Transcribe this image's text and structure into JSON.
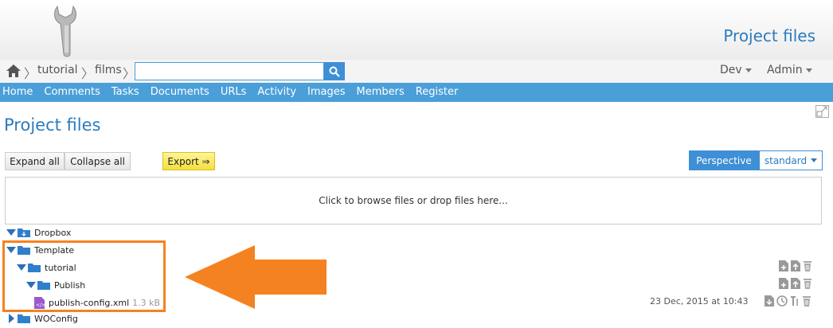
{
  "header": {
    "site_title": "Project files"
  },
  "breadcrumb": {
    "items": [
      "tutorial",
      "films"
    ],
    "separator": "〉"
  },
  "search": {
    "value": "",
    "placeholder": ""
  },
  "top_menu": {
    "dev_label": "Dev",
    "admin_label": "Admin"
  },
  "nav": {
    "items": [
      "Home",
      "Comments",
      "Tasks",
      "Documents",
      "URLs",
      "Activity",
      "Images",
      "Members",
      "Register"
    ]
  },
  "page": {
    "title": "Project files"
  },
  "toolbar": {
    "expand_all": "Expand all",
    "collapse_all": "Collapse all",
    "export": "Export ⇒",
    "perspective_label": "Perspective",
    "perspective_value": "standard"
  },
  "dropzone": {
    "text": "Click to browse files or drop files here..."
  },
  "tree": {
    "dropbox": "Dropbox",
    "template": "Template",
    "tutorial": "tutorial",
    "publish": "Publish",
    "file_name": "publish-config.xml",
    "file_size": "1.3 kB",
    "file_date": "23 Dec, 2015 at 10:43",
    "woconfig": "WOConfig"
  },
  "colors": {
    "brand_blue": "#2b7bbf",
    "nav_blue": "#4b9fd9",
    "highlight_orange": "#f58220",
    "export_yellow": "#f4df3c"
  },
  "icons": [
    "wrench-logo-icon",
    "home-icon",
    "search-icon",
    "expand-window-icon",
    "folder-icon",
    "file-xml-icon",
    "add-file-icon",
    "upload-icon",
    "delete-icon",
    "download-icon",
    "history-icon"
  ]
}
